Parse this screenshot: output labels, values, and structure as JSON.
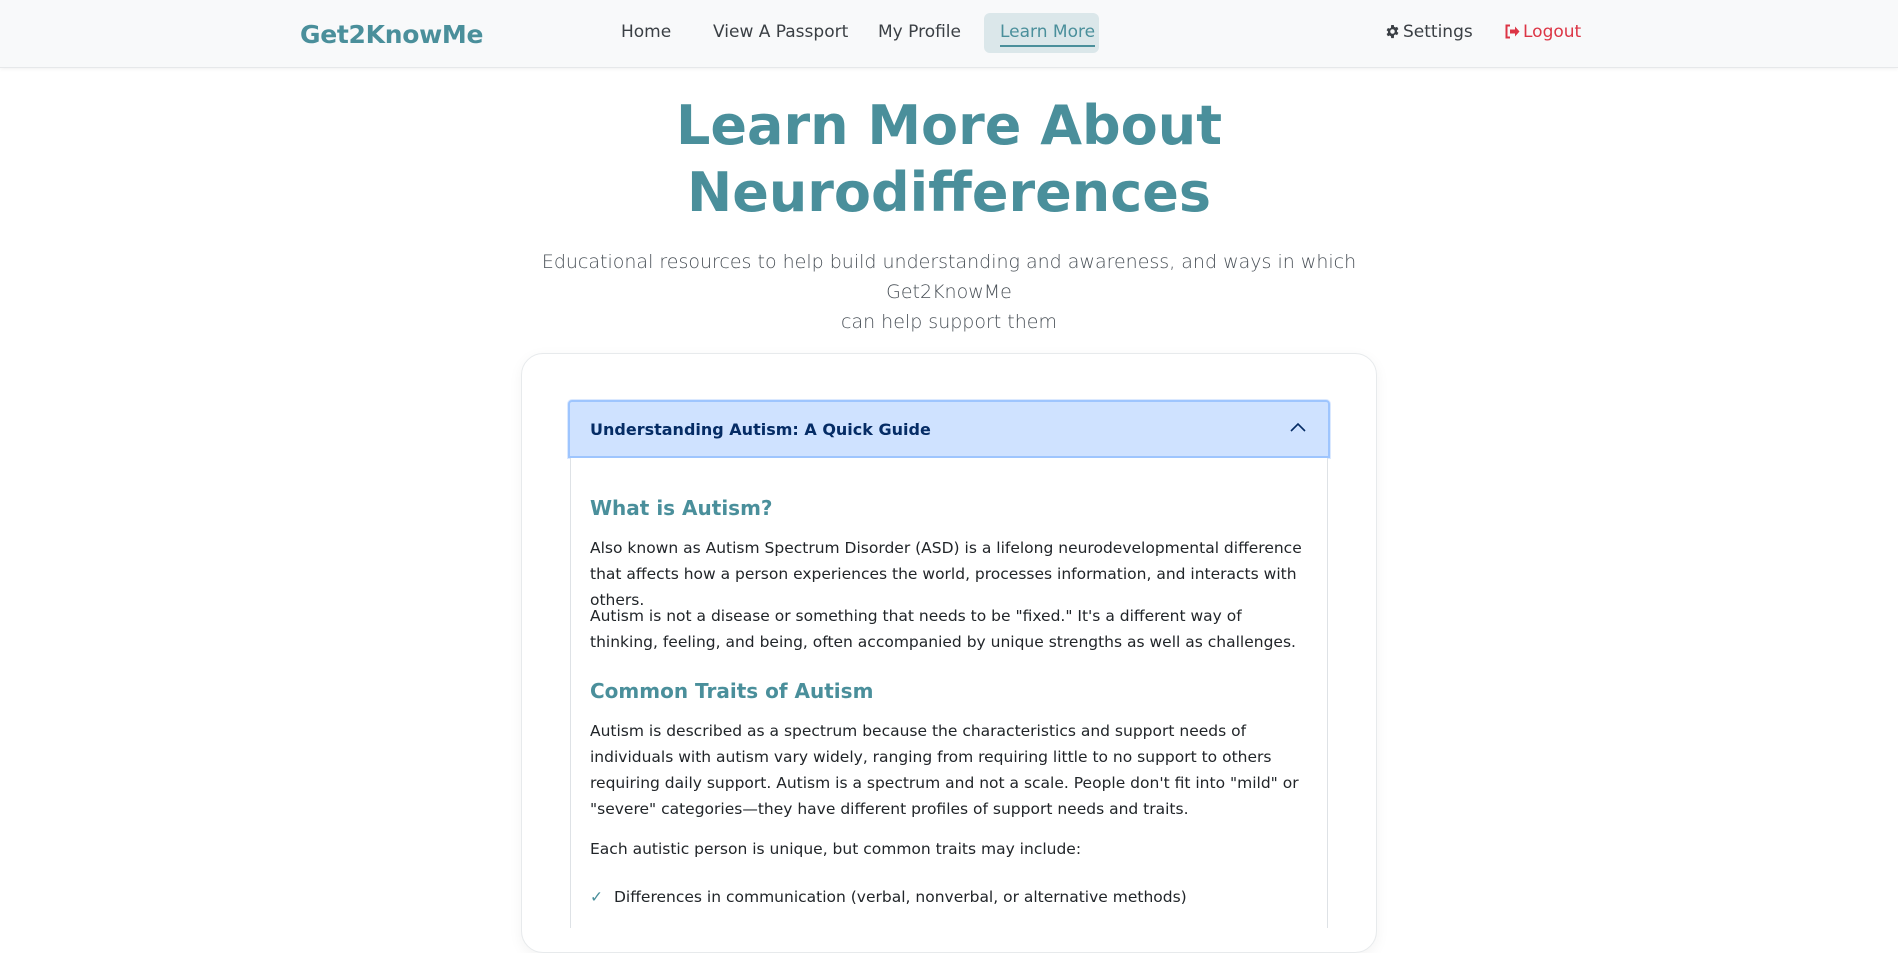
{
  "navbar": {
    "brand": "Get2KnowMe",
    "links": {
      "home": "Home",
      "passport": "View A Passport",
      "profile": "My Profile",
      "learn": "Learn More"
    },
    "settings": "Settings",
    "logout": "Logout",
    "accent_color": "#4a8f9b",
    "logout_color": "#dc3545"
  },
  "hero": {
    "title_line1": "Learn More About",
    "title_line2": "Neurodifferences",
    "subtitle_line1": "Educational resources to help build understanding and awareness, and ways in which Get2KnowMe",
    "subtitle_line2": "can help support them"
  },
  "accordion": {
    "title": "Understanding Autism: A Quick Guide",
    "expanded": true,
    "sections": {
      "what": {
        "heading": "What is Autism?",
        "p1": "Also known as Autism Spectrum Disorder (ASD) is a lifelong neurodevelopmental difference that affects how a person experiences the world, processes information, and interacts with others.",
        "p2": "Autism is not a disease or something that needs to be \"fixed.\" It's a different way of thinking, feeling, and being, often accompanied by unique strengths as well as challenges."
      },
      "traits": {
        "heading": "Common Traits of Autism",
        "p1": "Autism is described as a spectrum because the characteristics and support needs of individuals with autism vary widely, ranging from requiring little to no support to others requiring daily support. Autism is a spectrum and not a scale. People don't fit into \"mild\" or \"severe\" categories—they have different profiles of support needs and traits.",
        "p2": "Each autistic person is unique, but common traits may include:",
        "items": [
          "Differences in communication (verbal, nonverbal, or alternative methods)"
        ]
      }
    }
  }
}
